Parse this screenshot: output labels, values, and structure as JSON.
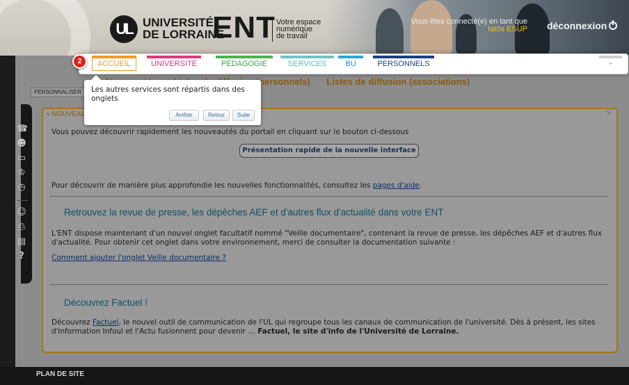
{
  "header": {
    "university_name_line1": "UNIVERSITÉ",
    "university_name_line2": "DE LORRAINE",
    "logo_mark": "UL",
    "ent_label": "ENT",
    "ent_sub_line1": "Votre espace",
    "ent_sub_line2": "numérique",
    "ent_sub_line3": "de travail",
    "connected_label": "Vous êtes connecté(e) en tant que",
    "user_name": "Iatôs ESUP",
    "logout_label": "déconnexion",
    "logout_icon": "power-icon"
  },
  "tabs": {
    "step_number": "2",
    "items": [
      {
        "label": "ACCUEIL",
        "color": "#f39a24",
        "text_color": "#f39a24"
      },
      {
        "label": "UNIVERSITÉ",
        "color": "#e0367c",
        "text_color": "#d2397c"
      },
      {
        "label": "PÉDAGOGIE",
        "color": "#48b44e",
        "text_color": "#3aa447"
      },
      {
        "label": "SERVICES",
        "color": "#6dc6c4",
        "text_color": "#58b9b6"
      },
      {
        "label": "BU",
        "color": "#2aa7d4",
        "text_color": "#1b8fc0"
      },
      {
        "label": "PERSONNELS",
        "color": "#1a3f8a",
        "text_color": "#1a3f8a"
      }
    ],
    "add_label": "+"
  },
  "subnav": {
    "items": [
      "Nouveautés",
      "Listes de diffusion (personnels)",
      "Listes de diffusion (associations)"
    ]
  },
  "personalize_label": "PERSONNALISER ▲",
  "sidebar_icons": [
    "phone-icon",
    "user-icon",
    "card-icon",
    "graduation-icon",
    "clock-icon",
    "person-icon",
    "print-icon",
    "calendar-icon",
    "help-icon"
  ],
  "sidebar_glyphs": [
    "☎",
    "☻",
    "▭",
    "♔",
    "◷",
    "☺",
    "⎙",
    "▤",
    "?"
  ],
  "portlet": {
    "title": "» NOUVEAU",
    "close": "⇲",
    "intro": "Vous pouvez découvrir rapidement les nouveautés du portail en cliquant sur le bouton ci-dessous",
    "present_button": "Présentation rapide de la nouvelle interface",
    "more_prefix": "Pour découvrir de manière plus approfondie les nouvelles fonctionnalités, consultez les ",
    "more_link": "pages d'aide",
    "more_suffix": ".",
    "section1_title": "Retrouvez la revue de presse, les dépêches AEF et d'autres flux d'actualité dans votre ENT",
    "section1_text": "L'ENT dispose maintenant d'un nouvel onglet facultatif nommé \"Veille documentaire\", contenant la revue de presse, les dépêches AEF et d'autres flux d'actualité. Pour obtenir cet onglet dans votre environnement, merci de consulter la documentation suivante :",
    "section1_link": "Comment ajouter l'onglet Veille documentaire ?",
    "section2_title": "Découvrez Factuel !",
    "section2_prefix": "Découvrez ",
    "section2_link": "Factuel",
    "section2_text": ", le nouvel outil de communication de l'UL qui regroupe tous les canaux de communication de l'université. Dès à présent, les sites d'information Infoul et l'Actu fusionnent pour devenir … ",
    "section2_bold": "Factuel, le site d'info de l'Université de Lorraine."
  },
  "footer": {
    "label": "PLAN DE SITE"
  },
  "tooltip": {
    "text": "Les autres services sont répartis dans des onglets",
    "stop_label": "Arrêter",
    "back_label": "Retour",
    "next_label": "Suite"
  }
}
